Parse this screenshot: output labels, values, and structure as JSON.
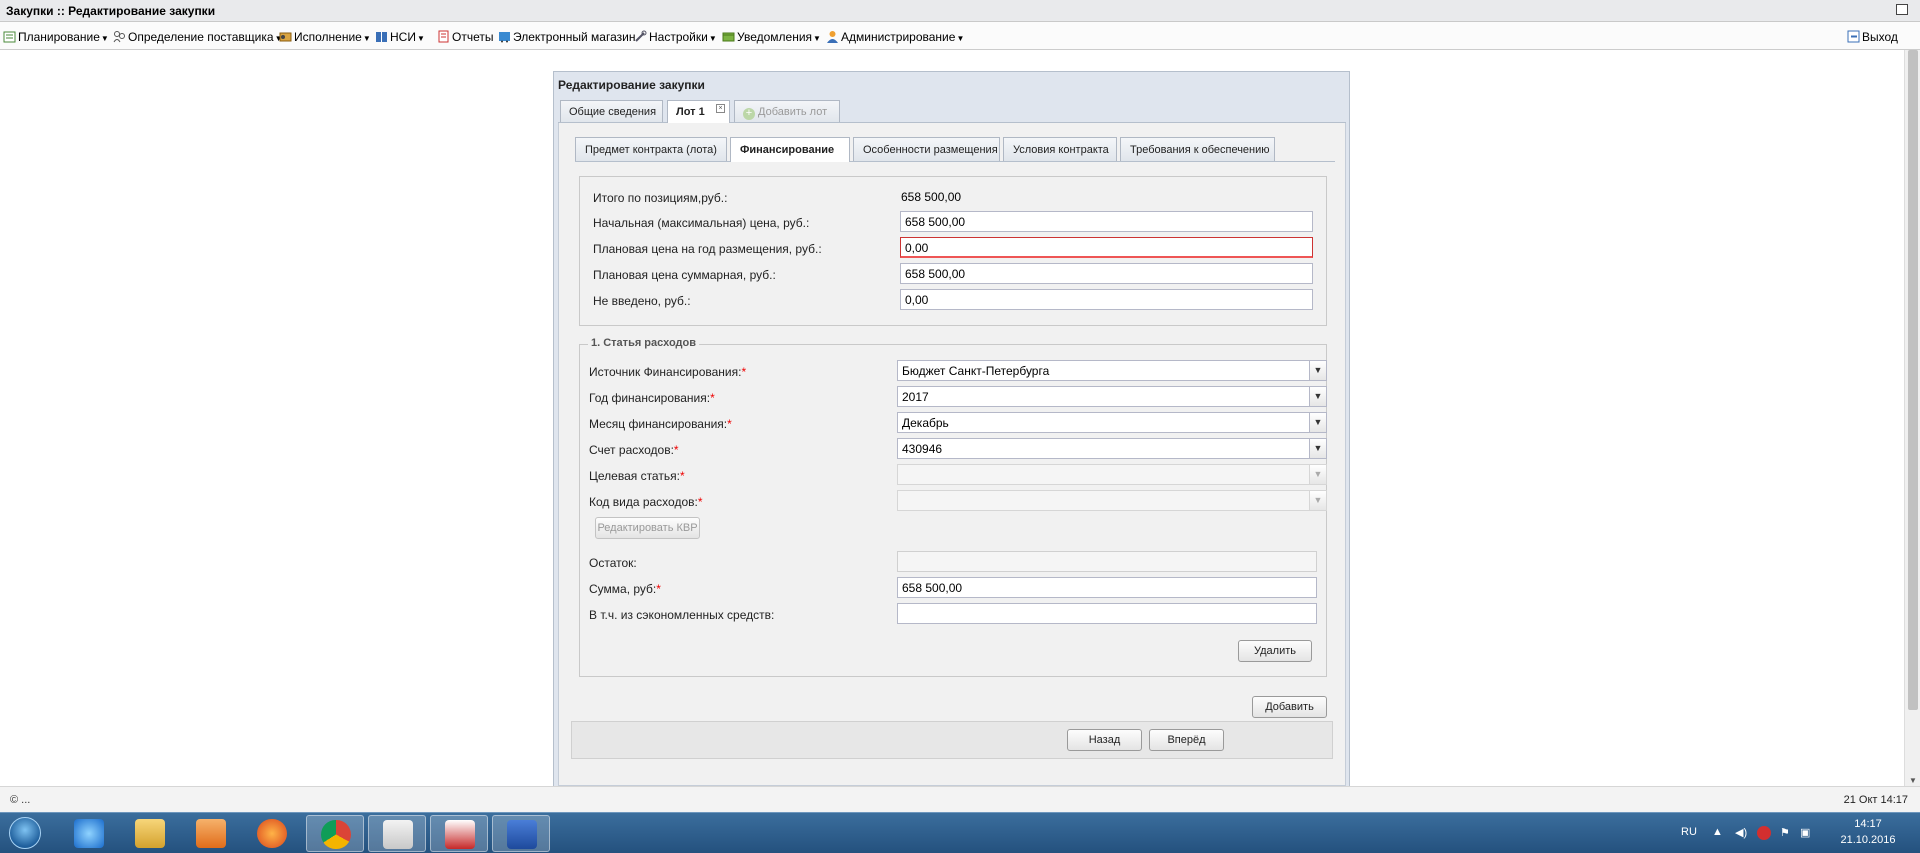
{
  "window": {
    "title": "Закупки :: Редактирование закупки"
  },
  "menu": {
    "items": [
      {
        "label": "Планирование"
      },
      {
        "label": "Определение поставщика"
      },
      {
        "label": "Исполнение"
      },
      {
        "label": "НСИ"
      },
      {
        "label": "Отчеты"
      },
      {
        "label": "Электронный магазин"
      },
      {
        "label": "Настройки"
      },
      {
        "label": "Уведомления"
      },
      {
        "label": "Администрирование"
      }
    ],
    "exit_label": "Выход"
  },
  "dialog": {
    "title": "Редактирование закупки",
    "outer_tabs": [
      "Общие сведения",
      "Лот 1",
      "Добавить лот"
    ],
    "inner_tabs": [
      "Предмет контракта (лота)",
      "Финансирование",
      "Особенности размещения",
      "Условия контракта",
      "Требования к обеспечению"
    ],
    "summary": {
      "total_label": "Итого по позициям,руб.:",
      "total_value": "658 500,00",
      "nmc_label": "Начальная (максимальная) цена, руб.:",
      "nmc_value": "658 500,00",
      "plan_year_label": "Плановая цена на год размещения, руб.:",
      "plan_year_value": "0,00",
      "plan_total_label": "Плановая цена суммарная, руб.:",
      "plan_total_value": "658 500,00",
      "not_entered_label": "Не введено, руб.:",
      "not_entered_value": "0,00"
    },
    "expense": {
      "legend": "1. Статья расходов",
      "source_label": "Источник Финансирования:",
      "source_value": "Бюджет Санкт-Петербурга",
      "year_label": "Год финансирования:",
      "year_value": "2017",
      "month_label": "Месяц финансирования:",
      "month_value": "Декабрь",
      "account_label": "Счет расходов:",
      "account_value": "430946",
      "target_label": "Целевая статья:",
      "target_value": "",
      "kvr_label": "Код вида расходов:",
      "kvr_value": "",
      "edit_kvr": "Редактировать КВР",
      "remainder_label": "Остаток:",
      "remainder_value": "",
      "sum_label": "Сумма, руб:",
      "sum_value": "658 500,00",
      "saved_label": "В т.ч. из сэкономленных средств:",
      "saved_value": "",
      "delete_label": "Удалить"
    },
    "add_label": "Добавить",
    "back_label": "Назад",
    "next_label": "Вперёд"
  },
  "status": {
    "left": "© ...",
    "right": "21 Окт 14:17"
  },
  "taskbar": {
    "lang": "RU",
    "time": "14:17",
    "date": "21.10.2016"
  },
  "colors": {
    "required": "#ee0000",
    "taskbar": "#2a5a8a",
    "dialog_header": "#dfe5ee"
  }
}
